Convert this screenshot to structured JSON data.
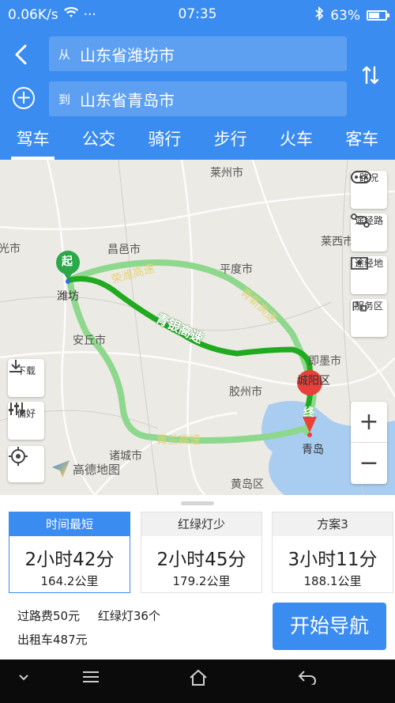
{
  "status": {
    "speed": "0.06K/s",
    "signal_icon": "wifi-icon",
    "more": "···",
    "time": "07:35",
    "battery": "63%",
    "battery_level": 0.63
  },
  "header": {
    "from_prefix": "从",
    "from_value": "山东省潍坊市",
    "to_prefix": "到",
    "to_value": "山东省青岛市",
    "swap_icon": "swap-icon",
    "tabs": [
      "驾车",
      "公交",
      "骑行",
      "步行",
      "火车",
      "客车"
    ],
    "active_tab": 0
  },
  "map": {
    "labels": {
      "laizhou": "莱州市",
      "changyi": "昌邑市",
      "pingdu": "平度市",
      "laixi": "莱西市",
      "weifang": "潍坊",
      "anqiu": "安丘市",
      "jimo": "即墨市",
      "chengyang": "城阳区",
      "jiaozhou": "胶州市",
      "qingdao": "青岛",
      "zhucheng": "诸城市",
      "huangdao": "黄岛区",
      "shouguang": "寿光市"
    },
    "roads": {
      "rongwei": "荣潍高速",
      "qingyin": "青银高速",
      "qingxin": "青新高速",
      "qinglan": "青兰高速"
    },
    "start_marker": "起",
    "end_marker": "终",
    "tools": {
      "traffic": "路况",
      "via_road": "途经路",
      "via_place": "途经地",
      "service": "服务区",
      "download": "下载",
      "prefs": "偏好"
    },
    "zoom_in": "+",
    "zoom_out": "−",
    "logo": "高德地图"
  },
  "routes": [
    {
      "tag": "时间最短",
      "time": "2小时42分",
      "dist": "164.2公里",
      "selected": true
    },
    {
      "tag": "红绿灯少",
      "time": "2小时45分",
      "dist": "179.2公里",
      "selected": false
    },
    {
      "tag": "方案3",
      "time": "3小时11分",
      "dist": "188.1公里",
      "selected": false
    }
  ],
  "info": {
    "toll": "过路费50元",
    "lights": "红绿灯36个",
    "taxi": "出租车487元"
  },
  "start_nav": "开始导航",
  "colors": {
    "brand": "#3a8cf0",
    "route_main": "#1faa1f",
    "route_alt": "#8ed88e",
    "end_pin": "#e8413b"
  }
}
